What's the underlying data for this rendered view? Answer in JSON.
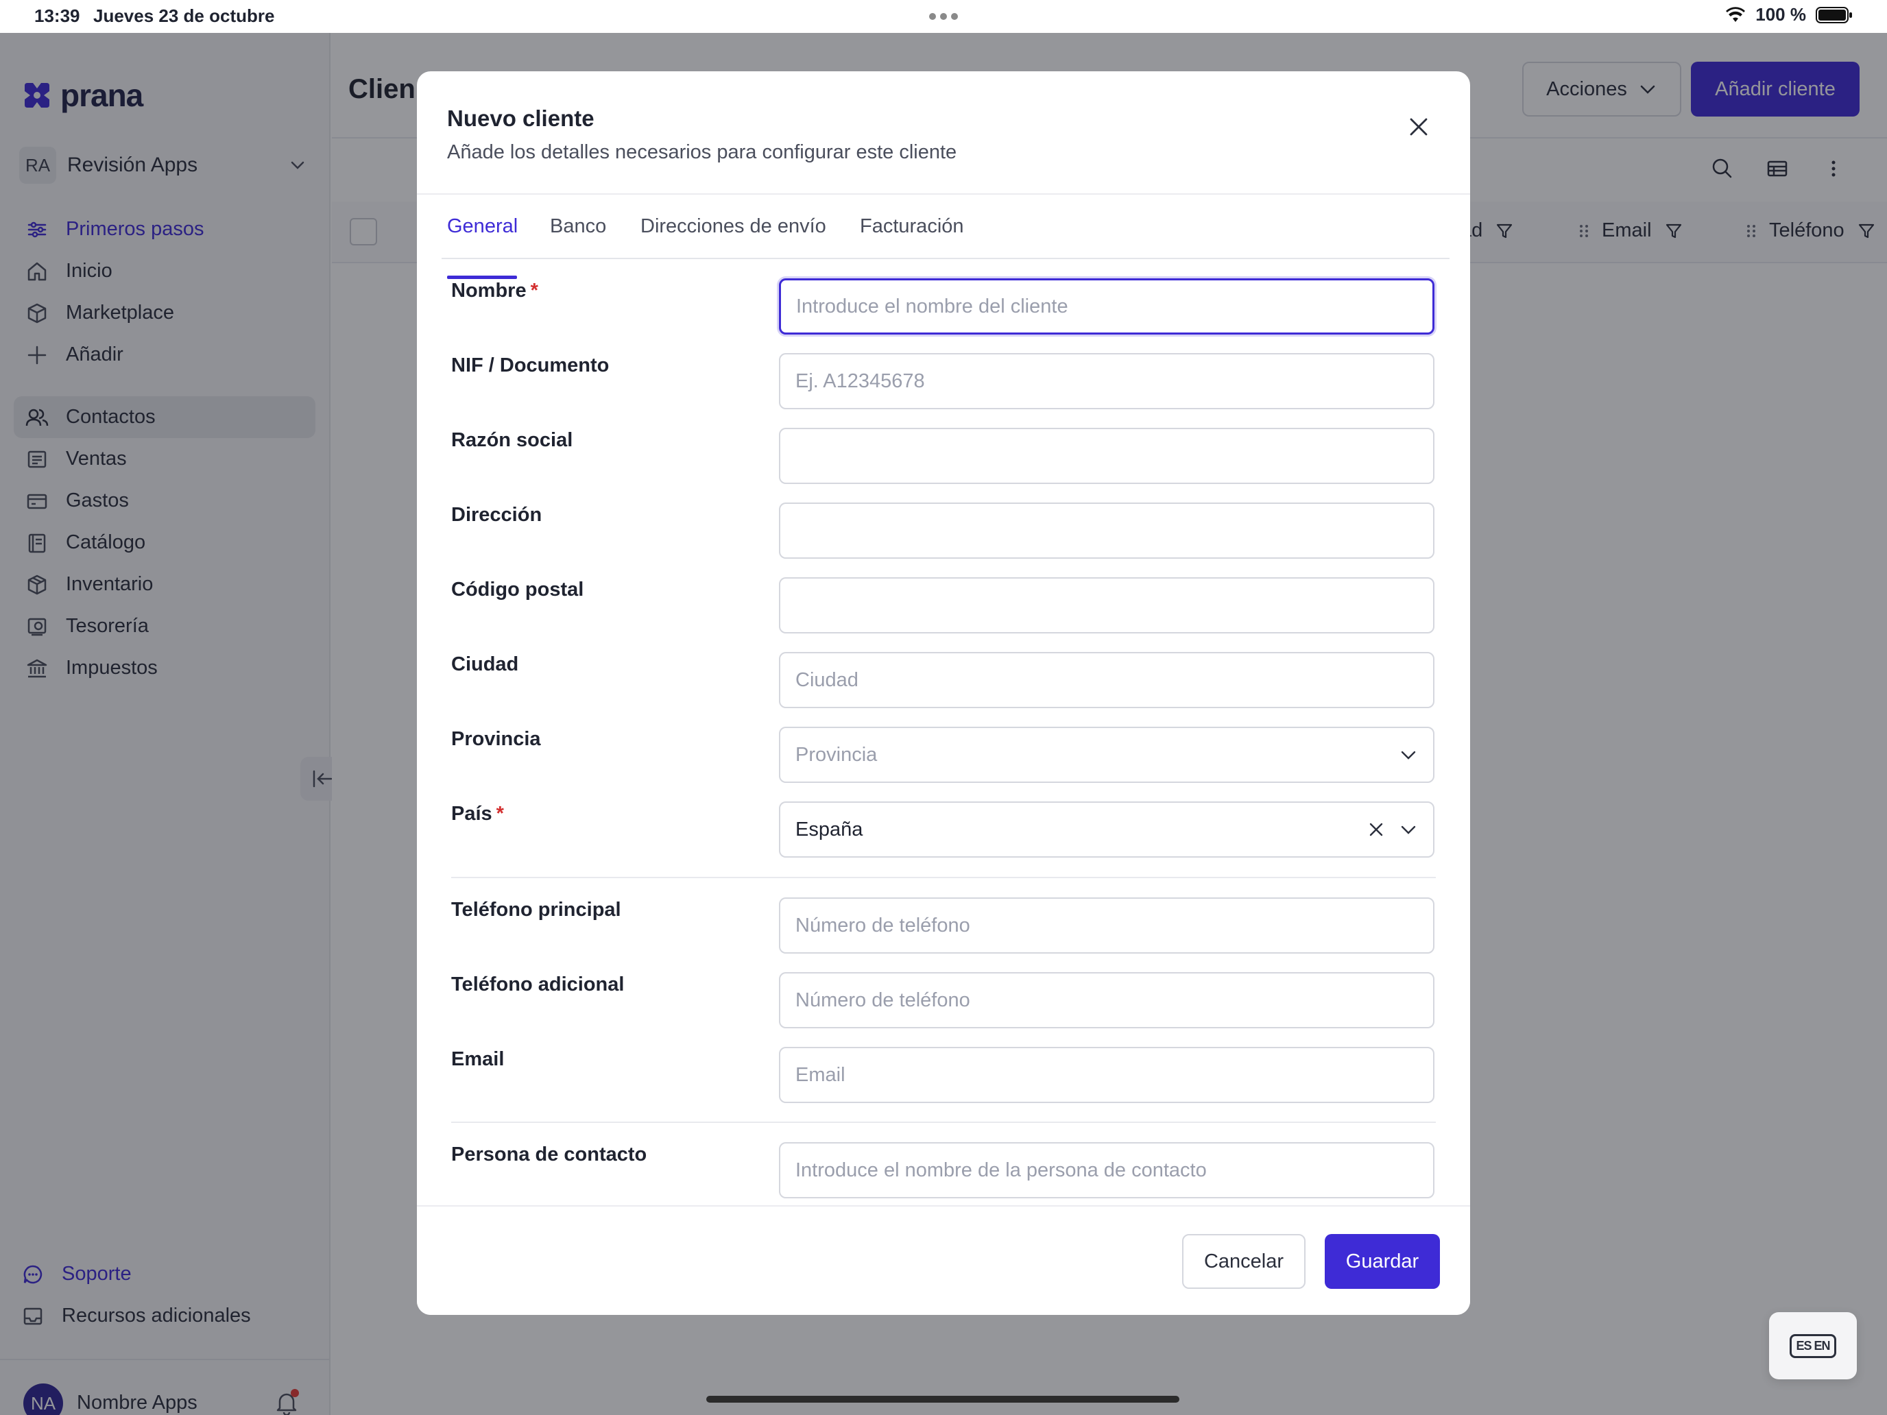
{
  "status_bar": {
    "time": "13:39",
    "date": "Jueves 23 de octubre",
    "battery": "100 %"
  },
  "sidebar": {
    "logo": "prana",
    "workspace": {
      "initials": "RA",
      "name": "Revisión Apps"
    },
    "primary": [
      {
        "label": "Primeros pasos",
        "icon": "sliders-icon"
      },
      {
        "label": "Inicio",
        "icon": "home-icon"
      },
      {
        "label": "Marketplace",
        "icon": "cube-icon"
      },
      {
        "label": "Añadir",
        "icon": "plus-icon"
      }
    ],
    "sections": [
      {
        "label": "Contactos",
        "icon": "users-icon"
      },
      {
        "label": "Ventas",
        "icon": "receipt-icon"
      },
      {
        "label": "Gastos",
        "icon": "card-icon"
      },
      {
        "label": "Catálogo",
        "icon": "catalog-icon"
      },
      {
        "label": "Inventario",
        "icon": "box-icon"
      },
      {
        "label": "Tesorería",
        "icon": "treasury-icon"
      },
      {
        "label": "Impuestos",
        "icon": "bank-icon"
      }
    ],
    "support": "Soporte",
    "resources": "Recursos adicionales",
    "user": {
      "initials": "NA",
      "name": "Nombre Apps"
    }
  },
  "main": {
    "title": "Clien",
    "actions_label": "Acciones",
    "add_label": "Añadir cliente",
    "columns": [
      "ad",
      "Email",
      "Teléfono"
    ]
  },
  "modal": {
    "title": "Nuevo cliente",
    "subtitle": "Añade los detalles necesarios para configurar este cliente",
    "tabs": [
      "General",
      "Banco",
      "Direcciones de envío",
      "Facturación"
    ],
    "fields": {
      "nombre": {
        "label": "Nombre",
        "required": "*",
        "placeholder": "Introduce el nombre del cliente",
        "value": ""
      },
      "nif": {
        "label": "NIF / Documento",
        "placeholder": "Ej. A12345678",
        "value": ""
      },
      "razon": {
        "label": "Razón social",
        "placeholder": "",
        "value": ""
      },
      "direccion": {
        "label": "Dirección",
        "placeholder": "",
        "value": ""
      },
      "cp": {
        "label": "Código postal",
        "placeholder": "",
        "value": ""
      },
      "ciudad": {
        "label": "Ciudad",
        "placeholder": "Ciudad",
        "value": ""
      },
      "provincia": {
        "label": "Provincia",
        "placeholder": "Provincia"
      },
      "pais": {
        "label": "País",
        "required": "*",
        "value": "España"
      },
      "tel1": {
        "label": "Teléfono principal",
        "placeholder": "Número de teléfono",
        "value": ""
      },
      "tel2": {
        "label": "Teléfono adicional",
        "placeholder": "Número de teléfono",
        "value": ""
      },
      "email": {
        "label": "Email",
        "placeholder": "Email",
        "value": ""
      },
      "contacto": {
        "label": "Persona de contacto",
        "placeholder": "Introduce el nombre de la persona de contacto",
        "value": ""
      }
    },
    "cancel_label": "Cancelar",
    "save_label": "Guardar"
  },
  "language_toggle": "ES EN",
  "colors": {
    "accent": "#3e2bd6",
    "required": "#d32f2f"
  }
}
